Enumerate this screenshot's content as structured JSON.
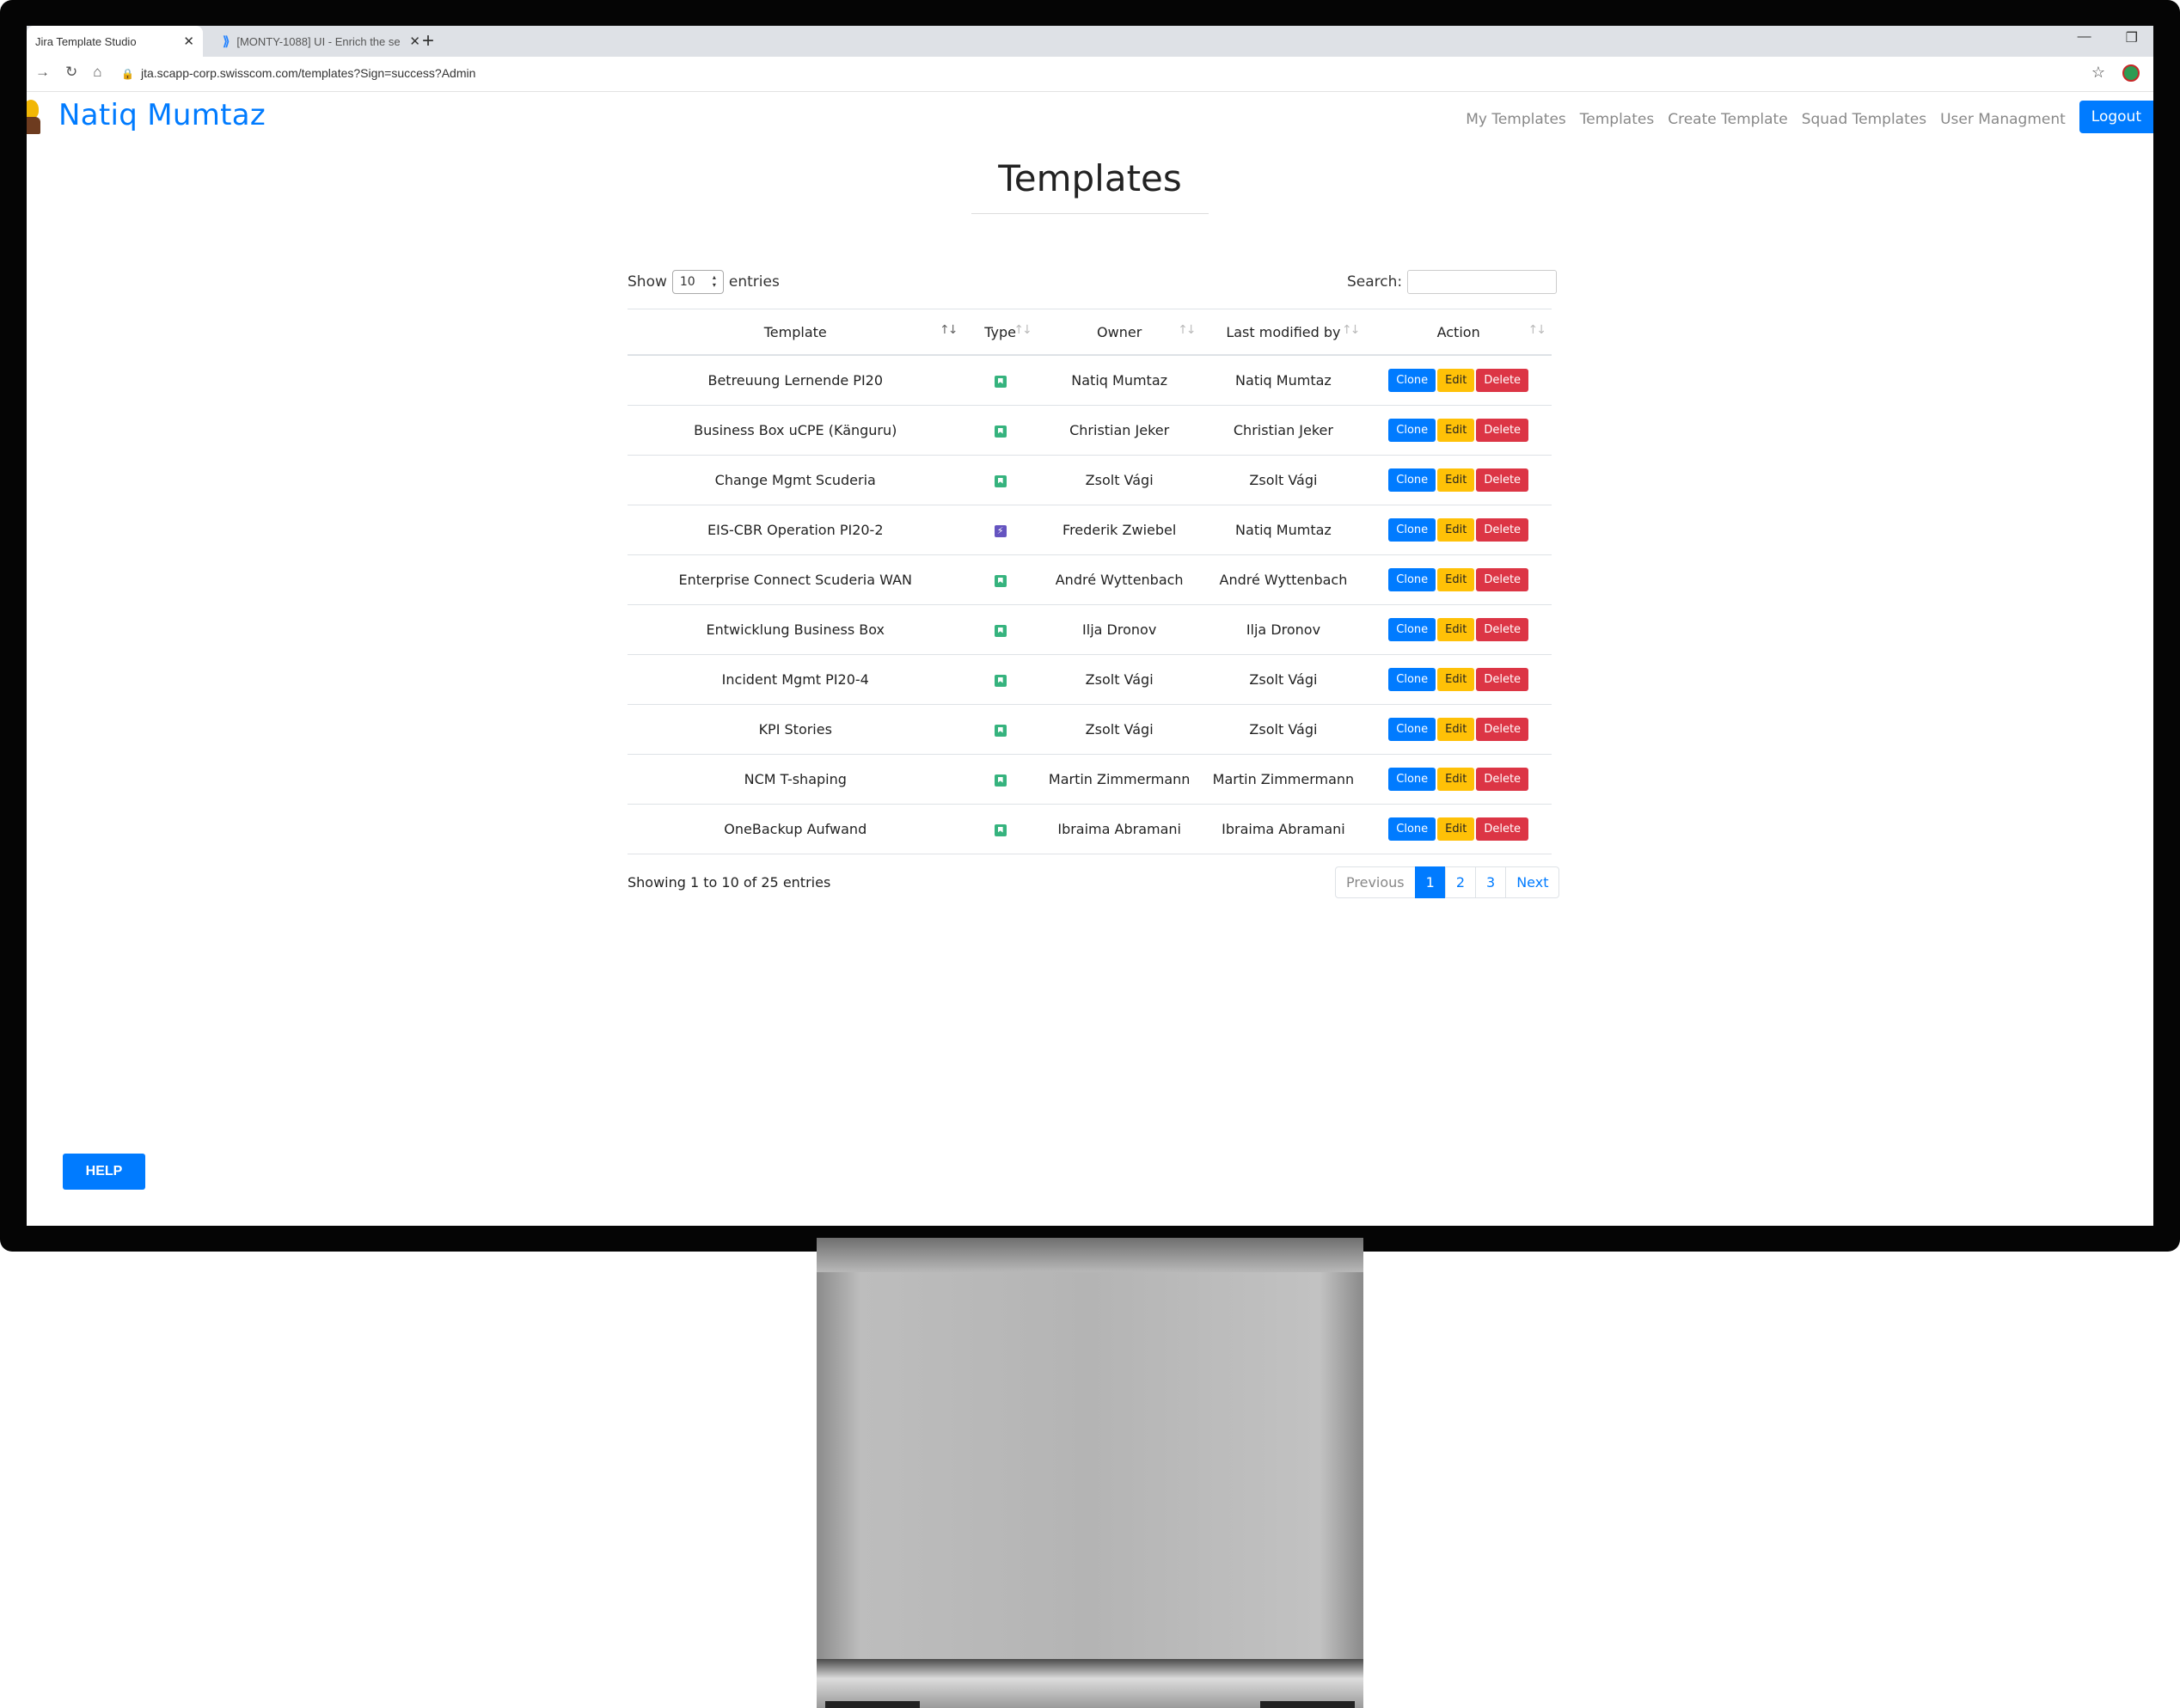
{
  "browser": {
    "tabs": [
      {
        "title": "Jira Template Studio",
        "active": true
      },
      {
        "title": "[MONTY-1088] UI - Enrich the se",
        "active": false
      }
    ],
    "url": "jta.scapp-corp.swisscom.com/templates?Sign=success?Admin"
  },
  "app": {
    "brand": "Natiq Mumtaz",
    "nav": [
      "My Templates",
      "Templates",
      "Create Template",
      "Squad Templates",
      "User Managment"
    ],
    "logout_label": "Logout",
    "page_title": "Templates",
    "help_label": "HELP"
  },
  "table_controls": {
    "show_label": "Show",
    "entries_value": "10",
    "entries_label": "entries",
    "search_label": "Search:"
  },
  "table": {
    "headers": [
      "Template",
      "Type",
      "Owner",
      "Last modified by",
      "Action"
    ],
    "actions": {
      "clone": "Clone",
      "edit": "Edit",
      "delete": "Delete"
    },
    "rows": [
      {
        "template": "Betreuung Lernende PI20",
        "type": "story",
        "owner": "Natiq Mumtaz",
        "modified_by": "Natiq Mumtaz"
      },
      {
        "template": "Business Box uCPE (Känguru)",
        "type": "story",
        "owner": "Christian Jeker",
        "modified_by": "Christian Jeker"
      },
      {
        "template": "Change Mgmt Scuderia",
        "type": "story",
        "owner": "Zsolt Vági",
        "modified_by": "Zsolt Vági"
      },
      {
        "template": "EIS-CBR Operation PI20-2",
        "type": "epic",
        "owner": "Frederik Zwiebel",
        "modified_by": "Natiq Mumtaz"
      },
      {
        "template": "Enterprise Connect Scuderia WAN",
        "type": "story",
        "owner": "André Wyttenbach",
        "modified_by": "André Wyttenbach"
      },
      {
        "template": "Entwicklung Business Box",
        "type": "story",
        "owner": "Ilja Dronov",
        "modified_by": "Ilja Dronov"
      },
      {
        "template": "Incident Mgmt PI20-4",
        "type": "story",
        "owner": "Zsolt Vági",
        "modified_by": "Zsolt Vági"
      },
      {
        "template": "KPI Stories",
        "type": "story",
        "owner": "Zsolt Vági",
        "modified_by": "Zsolt Vági"
      },
      {
        "template": "NCM T-shaping",
        "type": "story",
        "owner": "Martin Zimmermann",
        "modified_by": "Martin Zimmermann"
      },
      {
        "template": "OneBackup Aufwand",
        "type": "story",
        "owner": "Ibraima Abramani",
        "modified_by": "Ibraima Abramani"
      }
    ]
  },
  "pagination": {
    "info": "Showing 1 to 10 of 25 entries",
    "previous": "Previous",
    "pages": [
      "1",
      "2",
      "3"
    ],
    "current": "1",
    "next": "Next"
  },
  "colors": {
    "primary": "#007bff",
    "warning": "#ffc107",
    "danger": "#dc3545",
    "story_icon": "#36b37e",
    "epic_icon": "#6554c0"
  }
}
